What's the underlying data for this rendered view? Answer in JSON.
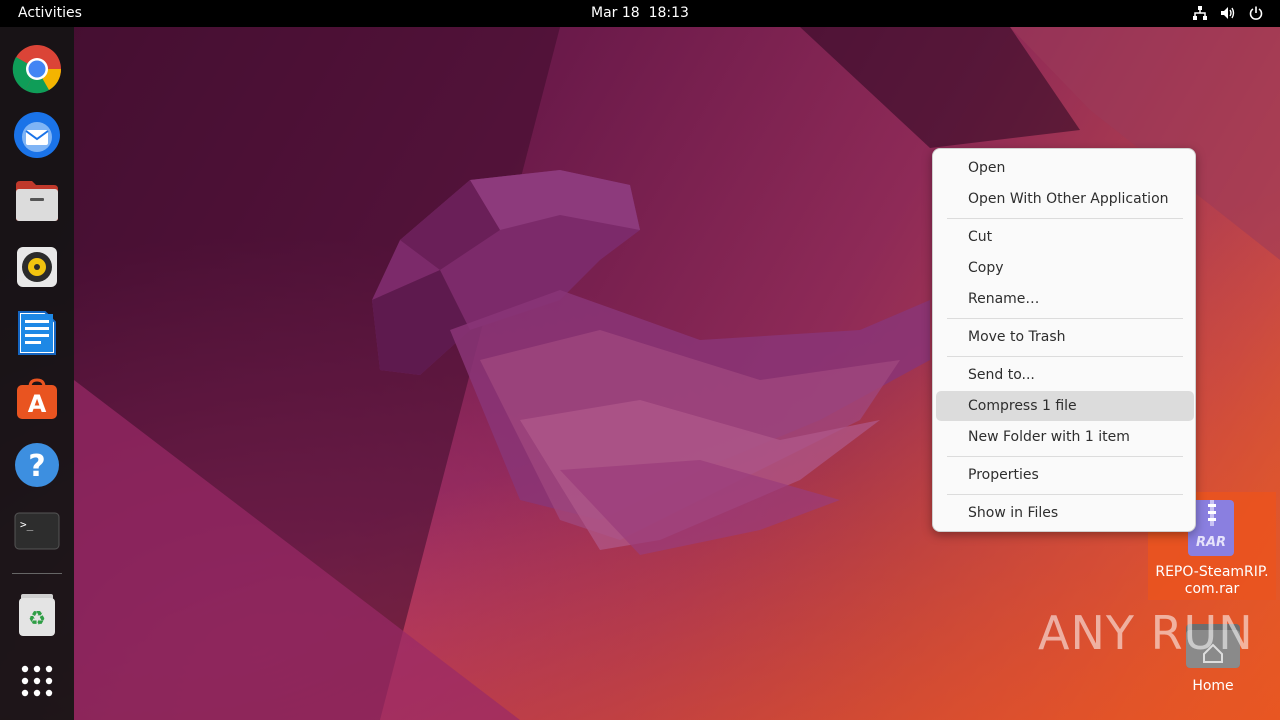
{
  "topbar": {
    "activities": "Activities",
    "date": "Mar 18",
    "time": "18:13",
    "tray_icons": [
      "network-icon",
      "volume-icon",
      "power-icon"
    ]
  },
  "dock": {
    "apps": [
      "chrome",
      "thunderbird",
      "files",
      "rhythmbox",
      "libreoffice-writer",
      "app-center",
      "help",
      "terminal",
      "trash",
      "show-apps"
    ]
  },
  "context_menu": {
    "items": [
      {
        "label": "Open"
      },
      {
        "label": "Open With Other Application"
      },
      {
        "label": "Cut"
      },
      {
        "label": "Copy"
      },
      {
        "label": "Rename…"
      },
      {
        "label": "Move to Trash"
      },
      {
        "label": "Send to..."
      },
      {
        "label": "Compress 1 file",
        "highlighted": true
      },
      {
        "label": "New Folder with 1 item"
      },
      {
        "label": "Properties"
      },
      {
        "label": "Show in Files"
      }
    ]
  },
  "desktop": {
    "rar_file": {
      "line1": "REPO-SteamRIP.",
      "line2": "com.rar",
      "badge": "RAR"
    },
    "home": {
      "label": "Home"
    }
  },
  "watermark": "ANY RUN",
  "colors": {
    "accent": "#e95420",
    "topbar": "#000000",
    "menu_bg": "#fafafa"
  }
}
